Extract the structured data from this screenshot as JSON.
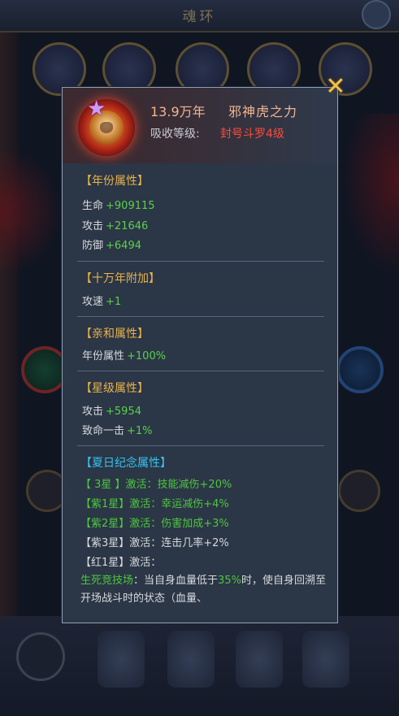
{
  "background": {
    "title": "魂环"
  },
  "tooltip": {
    "ring_age": "13.9万年",
    "ring_name": "邪神虎之力",
    "absorb_label": "吸收等级:",
    "absorb_value": "封号斗罗4级",
    "close_icon": "close-x-icon",
    "sections": {
      "year_attr": {
        "title": "【年份属性】",
        "rows": [
          {
            "key": "生命",
            "value": "+909115"
          },
          {
            "key": "攻击",
            "value": "+21646"
          },
          {
            "key": "防御",
            "value": "+6494"
          }
        ]
      },
      "hundred_k_bonus": {
        "title": "【十万年附加】",
        "rows": [
          {
            "key": "攻速",
            "value": "+1"
          }
        ]
      },
      "affinity": {
        "title": "【亲和属性】",
        "rows": [
          {
            "key": "年份属性",
            "value": "+100%"
          }
        ]
      },
      "star_attr": {
        "title": "【星级属性】",
        "rows": [
          {
            "key": "攻击",
            "value": "+5954"
          },
          {
            "key": "致命一击",
            "value": "+1%"
          }
        ]
      },
      "summer": {
        "title": "【夏日纪念属性】",
        "rows": [
          "【 3星 】激活：技能减伤+20%",
          "【紫1星】激活：幸运减伤+4%",
          "【紫2星】激活：伤害加成+3%",
          "【紫3星】激活：连击几率+2%",
          "【红1星】激活："
        ],
        "desc_prefix": "生死竞技场",
        "desc_mid": "：当自身血量低于",
        "desc_pct": "35%",
        "desc_rest": "时，使自身回溯至开场战斗时的状态（血量、"
      }
    }
  }
}
